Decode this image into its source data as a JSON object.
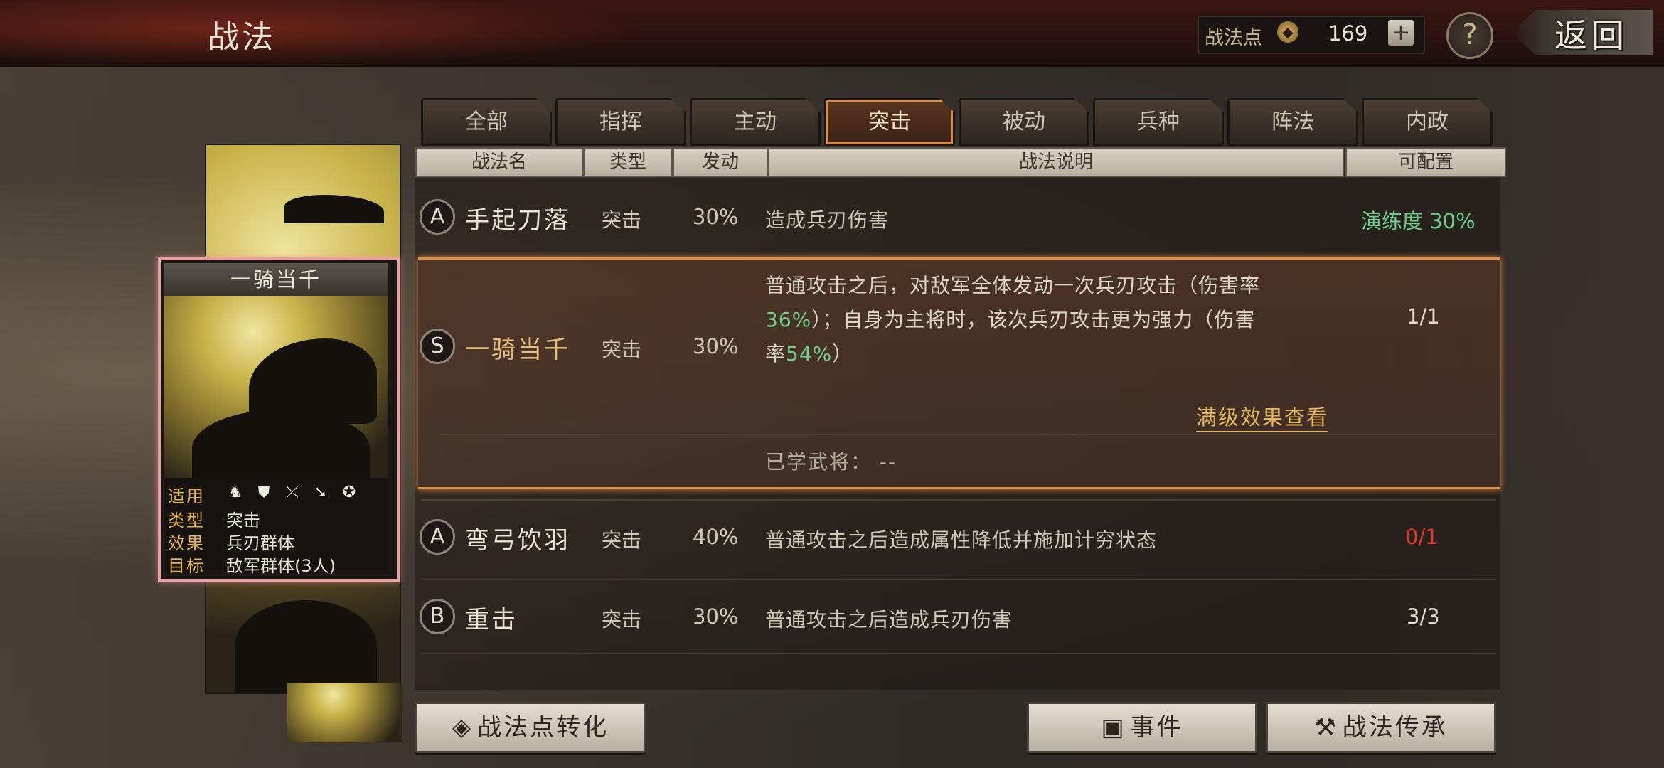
{
  "header": {
    "title": "战法",
    "points_label": "战法点",
    "points_icon": "tactic-point-icon",
    "points_value": "169",
    "plus_label": "+",
    "help_label": "?",
    "back_label": "返回"
  },
  "tabs": [
    {
      "label": "全部",
      "active": false
    },
    {
      "label": "指挥",
      "active": false
    },
    {
      "label": "主动",
      "active": false
    },
    {
      "label": "突击",
      "active": true
    },
    {
      "label": "被动",
      "active": false
    },
    {
      "label": "兵种",
      "active": false
    },
    {
      "label": "阵法",
      "active": false
    },
    {
      "label": "内政",
      "active": false
    }
  ],
  "columns": {
    "name": "战法名",
    "type": "类型",
    "trigger": "发动",
    "desc": "战法说明",
    "config": "可配置"
  },
  "tactics": [
    {
      "grade": "A",
      "name": "手起刀落",
      "type": "突击",
      "rate": "30%",
      "desc": "造成兵刃伤害",
      "config": "演练度 30%"
    },
    {
      "grade": "S",
      "name": "一骑当千",
      "type": "突击",
      "rate": "30%",
      "desc_parts": [
        "普通攻击之后，对敌军全体发动一次兵刃攻击（伤害率",
        "36%",
        "）；自身为主将时，该次兵刃攻击更为强力（伤害",
        "率",
        "54%",
        "）"
      ],
      "config": "1/1",
      "full_link": "满级效果查看",
      "learned": "已学武将：  --"
    },
    {
      "grade": "A",
      "name": "弯弓饮羽",
      "type": "突击",
      "rate": "40%",
      "desc": "普通攻击之后造成属性降低并施加计穷状态",
      "config": "0/1"
    },
    {
      "grade": "B",
      "name": "重击",
      "type": "突击",
      "rate": "30%",
      "desc": "普通攻击之后造成兵刃伤害",
      "config": "3/3"
    }
  ],
  "detail_card": {
    "title": "一骑当千",
    "rows": [
      {
        "key": "适用",
        "value": ""
      },
      {
        "key": "类型",
        "value": "突击"
      },
      {
        "key": "效果",
        "value": "兵刃群体"
      },
      {
        "key": "目标",
        "value": "敌军群体(3人)"
      }
    ],
    "troop_icons": [
      "cavalry-icon",
      "shield-icon",
      "bow-icon",
      "spear-icon",
      "wheel-icon"
    ]
  },
  "buttons": {
    "convert": "战法点转化",
    "events": "事件",
    "inherit": "战法传承"
  }
}
